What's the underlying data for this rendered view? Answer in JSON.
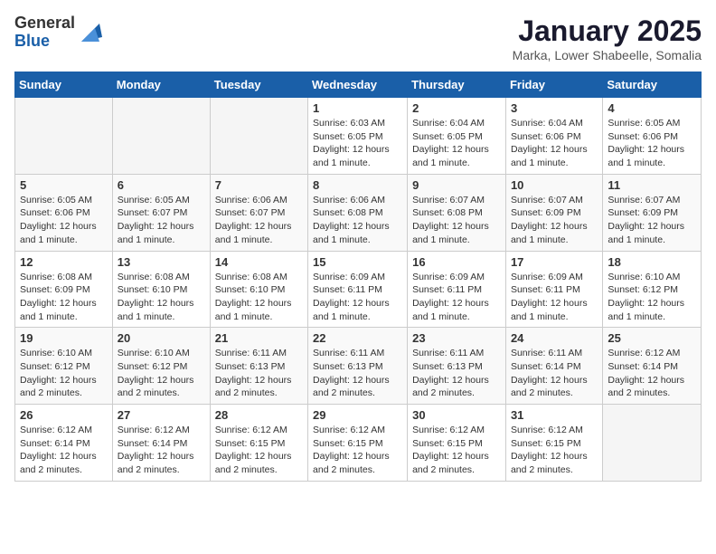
{
  "logo": {
    "general": "General",
    "blue": "Blue"
  },
  "header": {
    "month": "January 2025",
    "location": "Marka, Lower Shabeelle, Somalia"
  },
  "weekdays": [
    "Sunday",
    "Monday",
    "Tuesday",
    "Wednesday",
    "Thursday",
    "Friday",
    "Saturday"
  ],
  "weeks": [
    [
      {
        "day": "",
        "info": ""
      },
      {
        "day": "",
        "info": ""
      },
      {
        "day": "",
        "info": ""
      },
      {
        "day": "1",
        "info": "Sunrise: 6:03 AM\nSunset: 6:05 PM\nDaylight: 12 hours and 1 minute."
      },
      {
        "day": "2",
        "info": "Sunrise: 6:04 AM\nSunset: 6:05 PM\nDaylight: 12 hours and 1 minute."
      },
      {
        "day": "3",
        "info": "Sunrise: 6:04 AM\nSunset: 6:06 PM\nDaylight: 12 hours and 1 minute."
      },
      {
        "day": "4",
        "info": "Sunrise: 6:05 AM\nSunset: 6:06 PM\nDaylight: 12 hours and 1 minute."
      }
    ],
    [
      {
        "day": "5",
        "info": "Sunrise: 6:05 AM\nSunset: 6:06 PM\nDaylight: 12 hours and 1 minute."
      },
      {
        "day": "6",
        "info": "Sunrise: 6:05 AM\nSunset: 6:07 PM\nDaylight: 12 hours and 1 minute."
      },
      {
        "day": "7",
        "info": "Sunrise: 6:06 AM\nSunset: 6:07 PM\nDaylight: 12 hours and 1 minute."
      },
      {
        "day": "8",
        "info": "Sunrise: 6:06 AM\nSunset: 6:08 PM\nDaylight: 12 hours and 1 minute."
      },
      {
        "day": "9",
        "info": "Sunrise: 6:07 AM\nSunset: 6:08 PM\nDaylight: 12 hours and 1 minute."
      },
      {
        "day": "10",
        "info": "Sunrise: 6:07 AM\nSunset: 6:09 PM\nDaylight: 12 hours and 1 minute."
      },
      {
        "day": "11",
        "info": "Sunrise: 6:07 AM\nSunset: 6:09 PM\nDaylight: 12 hours and 1 minute."
      }
    ],
    [
      {
        "day": "12",
        "info": "Sunrise: 6:08 AM\nSunset: 6:09 PM\nDaylight: 12 hours and 1 minute."
      },
      {
        "day": "13",
        "info": "Sunrise: 6:08 AM\nSunset: 6:10 PM\nDaylight: 12 hours and 1 minute."
      },
      {
        "day": "14",
        "info": "Sunrise: 6:08 AM\nSunset: 6:10 PM\nDaylight: 12 hours and 1 minute."
      },
      {
        "day": "15",
        "info": "Sunrise: 6:09 AM\nSunset: 6:11 PM\nDaylight: 12 hours and 1 minute."
      },
      {
        "day": "16",
        "info": "Sunrise: 6:09 AM\nSunset: 6:11 PM\nDaylight: 12 hours and 1 minute."
      },
      {
        "day": "17",
        "info": "Sunrise: 6:09 AM\nSunset: 6:11 PM\nDaylight: 12 hours and 1 minute."
      },
      {
        "day": "18",
        "info": "Sunrise: 6:10 AM\nSunset: 6:12 PM\nDaylight: 12 hours and 1 minute."
      }
    ],
    [
      {
        "day": "19",
        "info": "Sunrise: 6:10 AM\nSunset: 6:12 PM\nDaylight: 12 hours and 2 minutes."
      },
      {
        "day": "20",
        "info": "Sunrise: 6:10 AM\nSunset: 6:12 PM\nDaylight: 12 hours and 2 minutes."
      },
      {
        "day": "21",
        "info": "Sunrise: 6:11 AM\nSunset: 6:13 PM\nDaylight: 12 hours and 2 minutes."
      },
      {
        "day": "22",
        "info": "Sunrise: 6:11 AM\nSunset: 6:13 PM\nDaylight: 12 hours and 2 minutes."
      },
      {
        "day": "23",
        "info": "Sunrise: 6:11 AM\nSunset: 6:13 PM\nDaylight: 12 hours and 2 minutes."
      },
      {
        "day": "24",
        "info": "Sunrise: 6:11 AM\nSunset: 6:14 PM\nDaylight: 12 hours and 2 minutes."
      },
      {
        "day": "25",
        "info": "Sunrise: 6:12 AM\nSunset: 6:14 PM\nDaylight: 12 hours and 2 minutes."
      }
    ],
    [
      {
        "day": "26",
        "info": "Sunrise: 6:12 AM\nSunset: 6:14 PM\nDaylight: 12 hours and 2 minutes."
      },
      {
        "day": "27",
        "info": "Sunrise: 6:12 AM\nSunset: 6:14 PM\nDaylight: 12 hours and 2 minutes."
      },
      {
        "day": "28",
        "info": "Sunrise: 6:12 AM\nSunset: 6:15 PM\nDaylight: 12 hours and 2 minutes."
      },
      {
        "day": "29",
        "info": "Sunrise: 6:12 AM\nSunset: 6:15 PM\nDaylight: 12 hours and 2 minutes."
      },
      {
        "day": "30",
        "info": "Sunrise: 6:12 AM\nSunset: 6:15 PM\nDaylight: 12 hours and 2 minutes."
      },
      {
        "day": "31",
        "info": "Sunrise: 6:12 AM\nSunset: 6:15 PM\nDaylight: 12 hours and 2 minutes."
      },
      {
        "day": "",
        "info": ""
      }
    ]
  ]
}
